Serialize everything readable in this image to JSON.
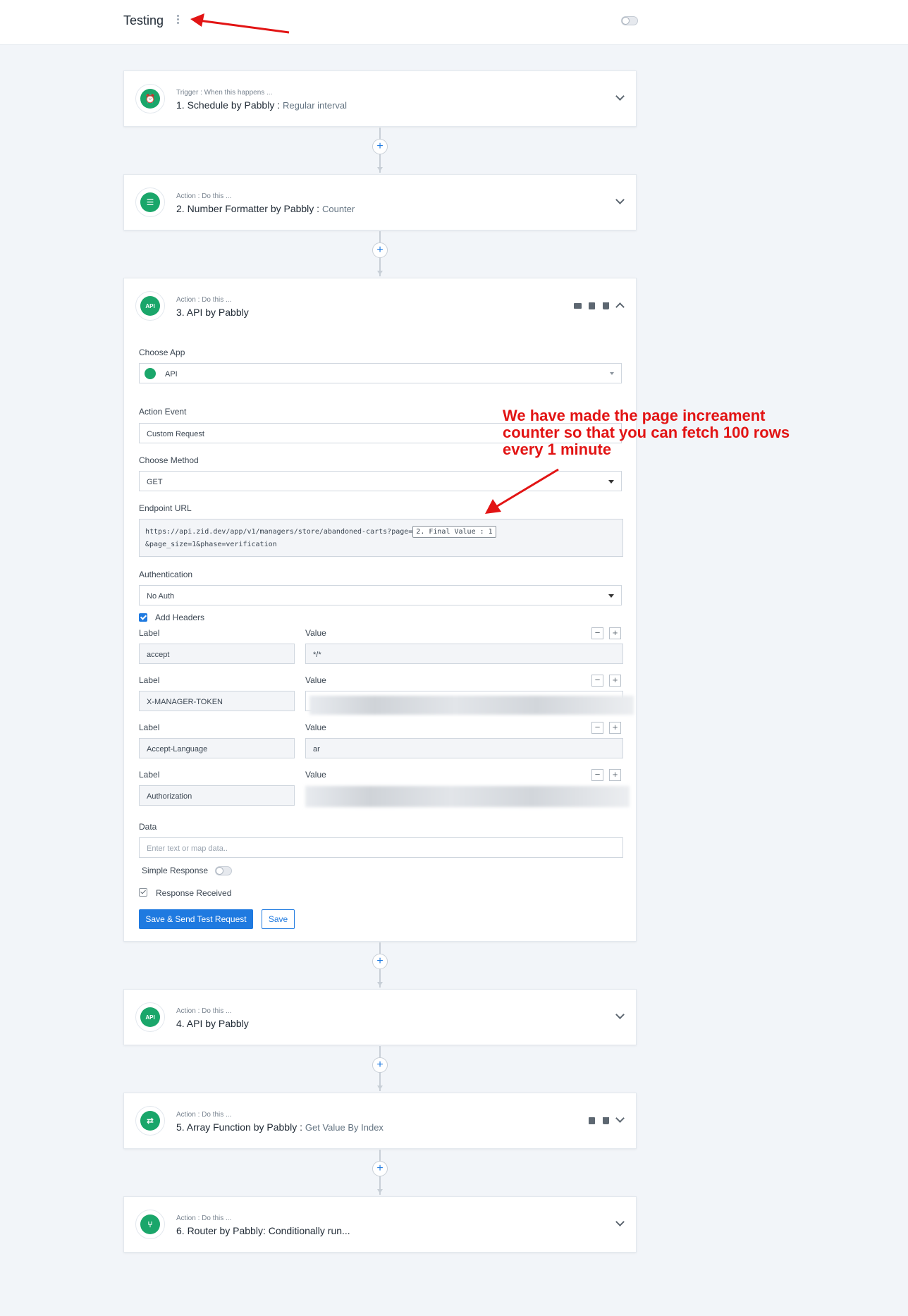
{
  "workflow": {
    "title": "Testing"
  },
  "steps": [
    {
      "kind": "Trigger : When this happens ...",
      "title": "1. Schedule by Pabbly :",
      "subtitle": "Regular interval"
    },
    {
      "kind": "Action : Do this ...",
      "title": "2. Number Formatter by Pabbly :",
      "subtitle": "Counter"
    },
    {
      "kind": "Action : Do this ...",
      "title": "3. API by Pabbly",
      "subtitle": ""
    },
    {
      "kind": "Action : Do this ...",
      "title": "4. API by Pabbly",
      "subtitle": ""
    },
    {
      "kind": "Action : Do this ...",
      "title": "5. Array Function by Pabbly :",
      "subtitle": "Get Value By Index"
    },
    {
      "kind": "Action : Do this ...",
      "title": "6. Router by Pabbly: Conditionally run...",
      "subtitle": ""
    }
  ],
  "icons": {
    "step1": "alarm-clock-icon",
    "step2": "list-format-icon",
    "step3": "api-icon",
    "step4": "api-icon",
    "step5": "array-function-icon",
    "step6": "router-branch-icon",
    "api_icon_text": "API"
  },
  "form": {
    "choose_app_label": "Choose App",
    "choose_app_value": "API",
    "action_event_label": "Action Event",
    "action_event_value": "Custom Request",
    "choose_method_label": "Choose Method",
    "choose_method_value": "GET",
    "endpoint_label": "Endpoint URL",
    "endpoint_part1": "https://api.zid.dev/app/v1/managers/store/abandoned-carts?page=",
    "endpoint_token": "2. Final Value : 1",
    "endpoint_part2": "&page_size=1&phase=verification",
    "auth_label": "Authentication",
    "auth_value": "No Auth",
    "add_headers_label": "Add Headers",
    "label_header": "Label",
    "value_header": "Value",
    "headers": [
      {
        "label": "accept",
        "value": "*/*"
      },
      {
        "label": "X-MANAGER-TOKEN",
        "value": ""
      },
      {
        "label": "Accept-Language",
        "value": "ar"
      },
      {
        "label": "Authorization",
        "value": ""
      }
    ],
    "minus": "−",
    "plus": "+",
    "data_label": "Data",
    "data_placeholder": "Enter text or map data..",
    "simple_response_label": "Simple Response",
    "response_received_label": "Response Received",
    "save_send_button": "Save & Send Test Request",
    "save_button": "Save"
  },
  "connector_plus": "+",
  "annotation": {
    "text": "We have made the page increament counter so that you can fetch 100 rows every 1 minute",
    "color": "#e21414"
  },
  "colors": {
    "accent": "#1f7ae0",
    "app_green": "#1aa66a",
    "annotation_red": "#e21414"
  }
}
